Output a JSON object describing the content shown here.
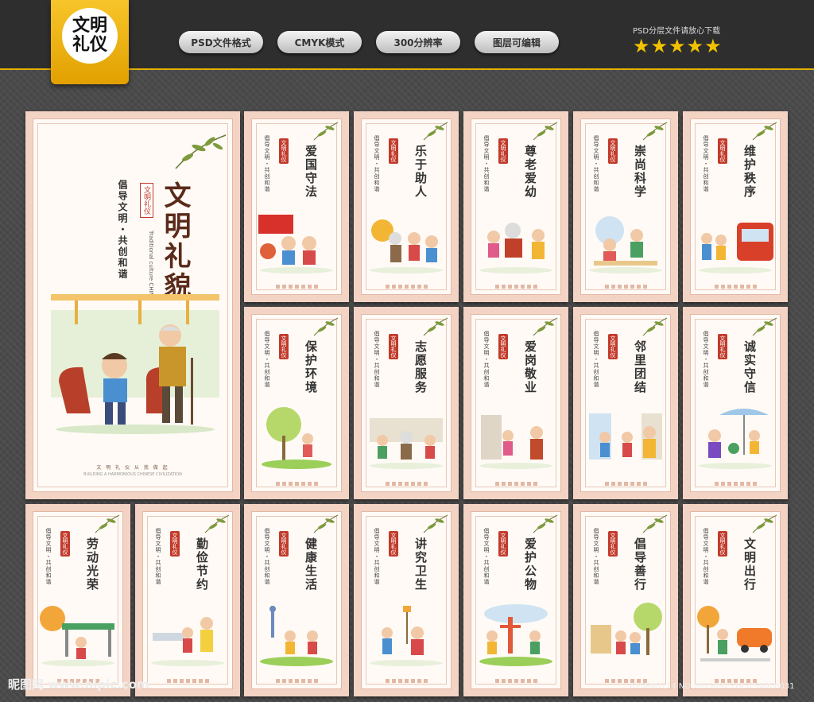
{
  "header": {
    "logo_text": "文明\n礼仪",
    "pills": [
      "PSD文件格式",
      "CMYK模式",
      "300分辨率",
      "图层可编辑"
    ],
    "download_note": "PSD分层文件请放心下载",
    "stars": "★★★★★"
  },
  "main_poster": {
    "title": "文明礼貌",
    "slogan": "倡导文明・共创和谐",
    "seal": "文明礼仪",
    "english": "Traditional culture CHINA",
    "footer": "文 明 礼 仪 从 我 做 起",
    "footer_en": "BUILDING A HARMONIOUS CHINESE CIVILIZATION"
  },
  "posters": [
    {
      "title": "爱国守法"
    },
    {
      "title": "乐于助人"
    },
    {
      "title": "尊老爱幼"
    },
    {
      "title": "崇尚科学"
    },
    {
      "title": "维护秩序"
    },
    {
      "title": "保护环境"
    },
    {
      "title": "志愿服务"
    },
    {
      "title": "爱岗敬业"
    },
    {
      "title": "邻里团结"
    },
    {
      "title": "诚实守信"
    },
    {
      "title": "劳动光荣"
    },
    {
      "title": "勤俭节约"
    },
    {
      "title": "健康生活"
    },
    {
      "title": "讲究卫生"
    },
    {
      "title": "爱护公物"
    },
    {
      "title": "倡导善行"
    },
    {
      "title": "文明出行"
    }
  ],
  "poster_slogan": "倡导文明・共创和谐",
  "watermark": "昵图网 www.nipic.com",
  "image_id": "ID:5848774 NO:20190925145250008031",
  "colors": {
    "accent": "#e2b100",
    "poster_border": "#f3d3c4",
    "title": "#333333",
    "seal": "#c23a2a"
  }
}
